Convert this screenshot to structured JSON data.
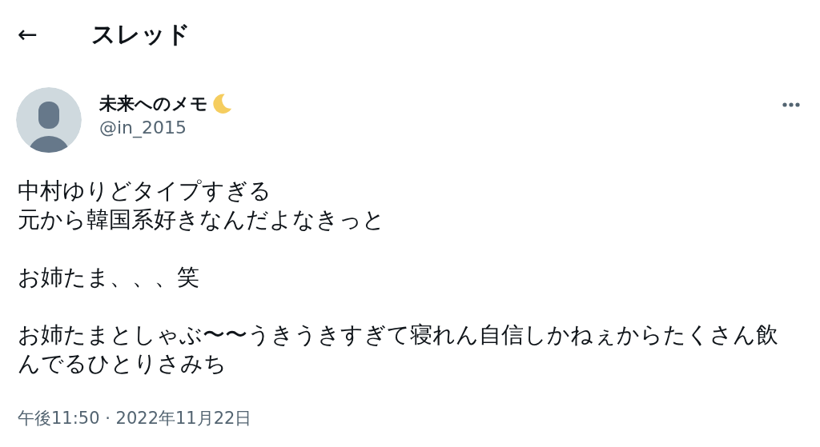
{
  "header": {
    "back": "←",
    "title": "スレッド"
  },
  "tweet": {
    "author": {
      "name": "未来へのメモ",
      "handle": "@in_2015"
    },
    "paragraphs": [
      [
        "中村ゆりどタイプすぎる",
        "元から韓国系好きなんだよなきっと"
      ],
      [
        "お姉たま、、、笑"
      ],
      [
        "お姉たまとしゃぶ〜〜うきうきすぎて寝れん自信しかねぇからたくさん飲んでるひとりさみち"
      ]
    ],
    "timestamp": "午後11:50 · 2022年11月22日"
  }
}
